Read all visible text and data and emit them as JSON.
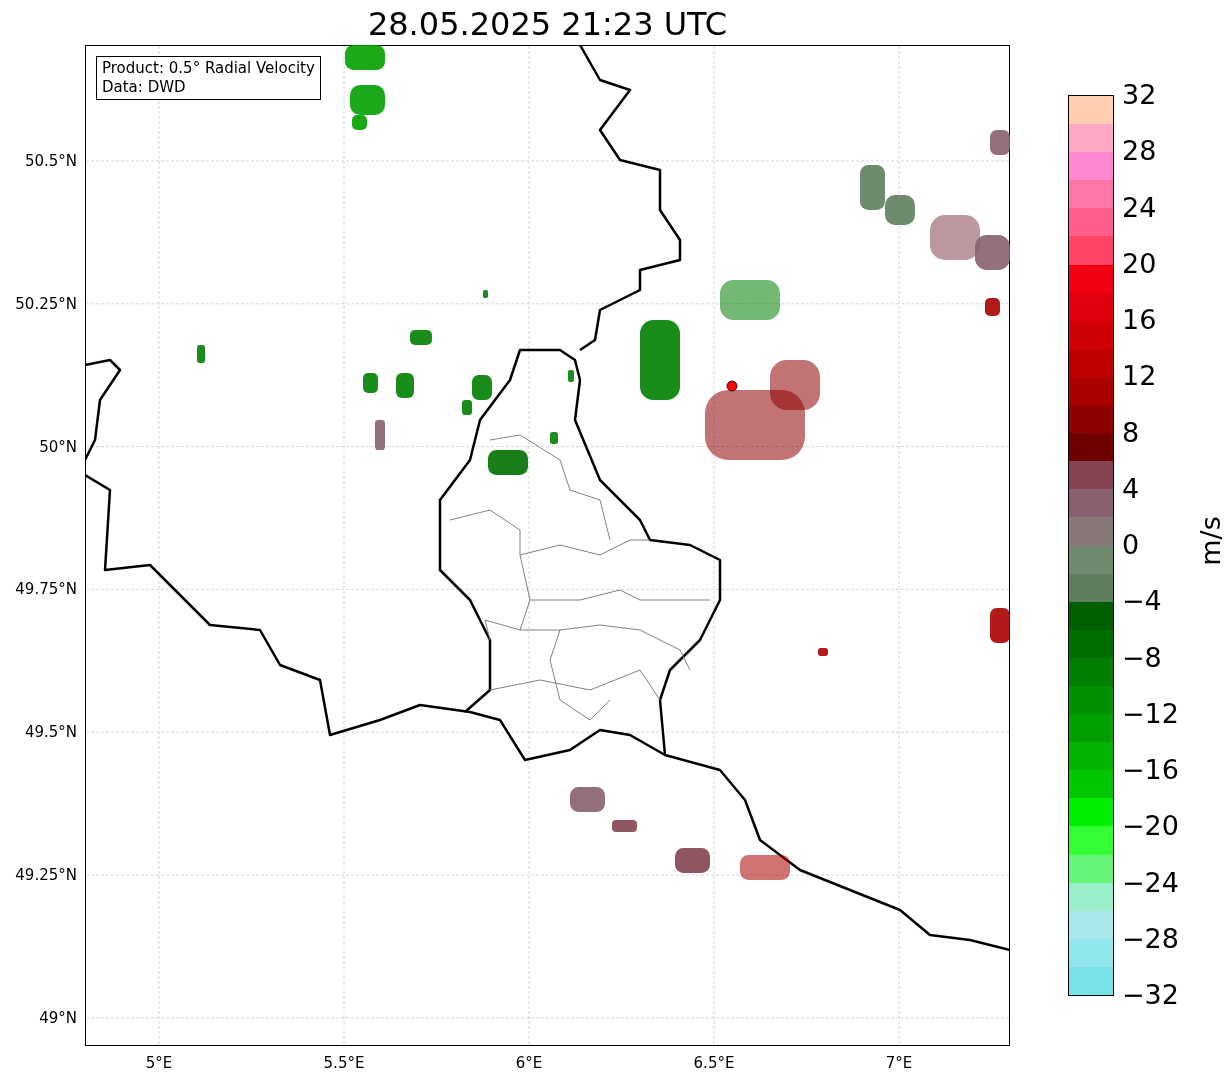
{
  "title": "28.05.2025 21:23 UTC",
  "legend": [
    "Product: 0.5° Radial Velocity",
    "Data: DWD"
  ],
  "x_ticks": [
    "5°E",
    "5.5°E",
    "6°E",
    "6.5°E",
    "7°E"
  ],
  "y_ticks": [
    "50.5°N",
    "50.25°N",
    "50°N",
    "49.75°N",
    "49.5°N",
    "49.25°N",
    "49°N"
  ],
  "colorbar": {
    "label": "m/s",
    "ticks": [
      "32",
      "28",
      "24",
      "20",
      "16",
      "12",
      "8",
      "4",
      "0",
      "−4",
      "−8",
      "−12",
      "−16",
      "−20",
      "−24",
      "−28",
      "−32"
    ],
    "segments": [
      {
        "color": "#ffcfaf"
      },
      {
        "color": "#ffa8c8"
      },
      {
        "color": "#ff88d0"
      },
      {
        "color": "#ff77a8"
      },
      {
        "color": "#ff5f8a"
      },
      {
        "color": "#ff4466"
      },
      {
        "color": "#f00010"
      },
      {
        "color": "#e00010"
      },
      {
        "color": "#d00008"
      },
      {
        "color": "#c00000"
      },
      {
        "color": "#aa0000"
      },
      {
        "color": "#900000"
      },
      {
        "color": "#700000"
      },
      {
        "color": "#844450"
      },
      {
        "color": "#886070"
      },
      {
        "color": "#887878"
      },
      {
        "color": "#6f8a6f"
      },
      {
        "color": "#5e7e5e"
      },
      {
        "color": "#005f00"
      },
      {
        "color": "#006f00"
      },
      {
        "color": "#008000"
      },
      {
        "color": "#009000"
      },
      {
        "color": "#00a000"
      },
      {
        "color": "#00b400"
      },
      {
        "color": "#00c800"
      },
      {
        "color": "#00ee00"
      },
      {
        "color": "#33ff33"
      },
      {
        "color": "#66f577"
      },
      {
        "color": "#99f0c8"
      },
      {
        "color": "#aae8ee"
      },
      {
        "color": "#90e8ee"
      },
      {
        "color": "#77e2e8"
      }
    ]
  }
}
